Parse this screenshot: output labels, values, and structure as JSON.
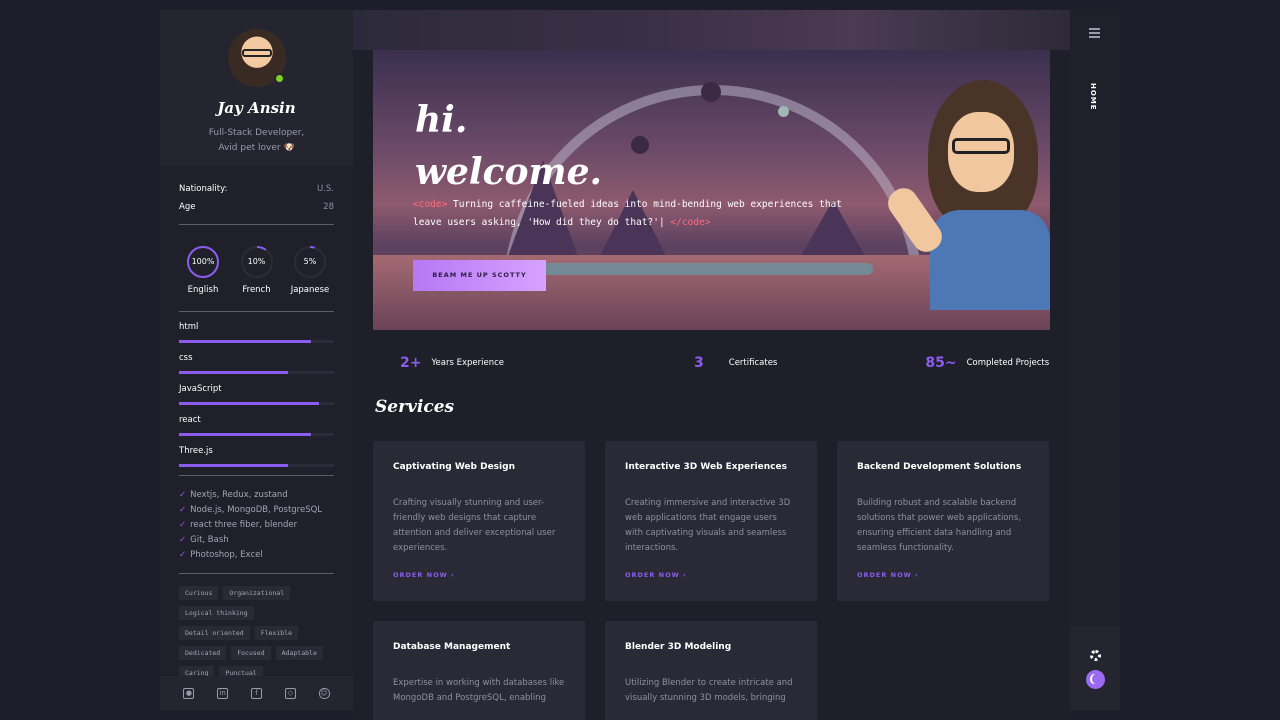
{
  "profile": {
    "name": "Jay Ansin",
    "role_line1": "Full-Stack Developer,",
    "role_line2": "Avid pet lover 🐶"
  },
  "info": [
    {
      "key": "Nationality:",
      "value": "U.S."
    },
    {
      "key": "Age",
      "value": "28"
    }
  ],
  "languages": [
    {
      "percent": "100%",
      "name": "English",
      "fill": 1.0
    },
    {
      "percent": "10%",
      "name": "French",
      "fill": 0.1
    },
    {
      "percent": "5%",
      "name": "Japanese",
      "fill": 0.05
    }
  ],
  "skills": [
    {
      "name": "html",
      "level": 0.85
    },
    {
      "name": "css",
      "level": 0.7
    },
    {
      "name": "JavaScript",
      "level": 0.9
    },
    {
      "name": "react",
      "level": 0.85
    },
    {
      "name": "Three.js",
      "level": 0.7
    }
  ],
  "tools": [
    "Nextjs, Redux, zustand",
    "Node.js, MongoDB, PostgreSQL",
    "react three fiber, blender",
    "Git, Bash",
    "Photoshop, Excel"
  ],
  "tags": [
    "Curious",
    "Organizational",
    "Logical thinking",
    "Detail oriented",
    "Flexible",
    "Dedicated",
    "Focused",
    "Adaptable",
    "Caring",
    "Punctual"
  ],
  "socials": [
    "github-icon",
    "linkedin-icon",
    "facebook-icon",
    "codepen-icon",
    "discord-icon"
  ],
  "hero": {
    "title_line1": "hi.",
    "title_line2": "welcome.",
    "code_open": "<code>",
    "text": " Turning caffeine-fueled ideas into mind-bending web experiences that leave users asking, 'How did they do that?'| ",
    "code_close": "</code>",
    "button": "BEAM ME UP SCOTTY"
  },
  "stats": [
    {
      "number": "2+",
      "label": "Years Experience"
    },
    {
      "number": "3",
      "label": "Certificates"
    },
    {
      "number": "85~",
      "label": "Completed Projects"
    }
  ],
  "services_title": "Services",
  "services": [
    {
      "title": "Captivating Web Design",
      "desc": "Crafting visually stunning and user-friendly web designs that capture attention and deliver exceptional user experiences.",
      "link": "ORDER NOW ›"
    },
    {
      "title": "Interactive 3D Web Experiences",
      "desc": "Creating immersive and interactive 3D web applications that engage users with captivating visuals and seamless interactions.",
      "link": "ORDER NOW ›"
    },
    {
      "title": "Backend Development Solutions",
      "desc": "Building robust and scalable backend solutions that power web applications, ensuring efficient data handling and seamless functionality.",
      "link": "ORDER NOW ›"
    },
    {
      "title": "Database Management",
      "desc": "Expertise in working with databases like MongoDB and PostgreSQL, enabling",
      "link": ""
    },
    {
      "title": "Blender 3D Modeling",
      "desc": "Utilizing Blender to create intricate and visually stunning 3D models, bringing",
      "link": ""
    }
  ],
  "rail": {
    "home": "HOME"
  },
  "colors": {
    "accent": "#8c5cf0",
    "background": "#1e1e2a",
    "card": "#2a2a36"
  }
}
